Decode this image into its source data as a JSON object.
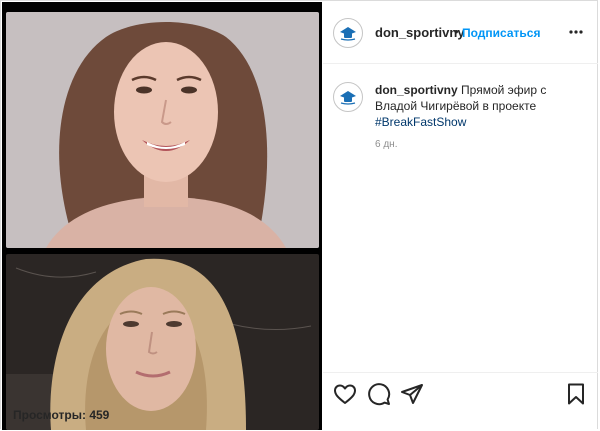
{
  "header": {
    "username": "don_sportivny",
    "separator": "•",
    "follow_label": "Подписаться",
    "more_icon": "more-horizontal-icon"
  },
  "caption": {
    "username": "don_sportivny",
    "text": "Прямой эфир с Владой Чигирёвой в проекте",
    "hashtag": "#BreakFastShow"
  },
  "timestamp": "6 дн.",
  "actions": {
    "like_icon": "heart-icon",
    "comment_icon": "comment-icon",
    "share_icon": "paper-plane-icon",
    "save_icon": "bookmark-icon"
  },
  "views": {
    "label": "Просмотры: 459"
  },
  "colors": {
    "link_blue": "#0095f6",
    "hashtag_blue": "#00376b",
    "text": "#262626",
    "muted": "#8e8e8e",
    "border": "#dbdbdb"
  }
}
